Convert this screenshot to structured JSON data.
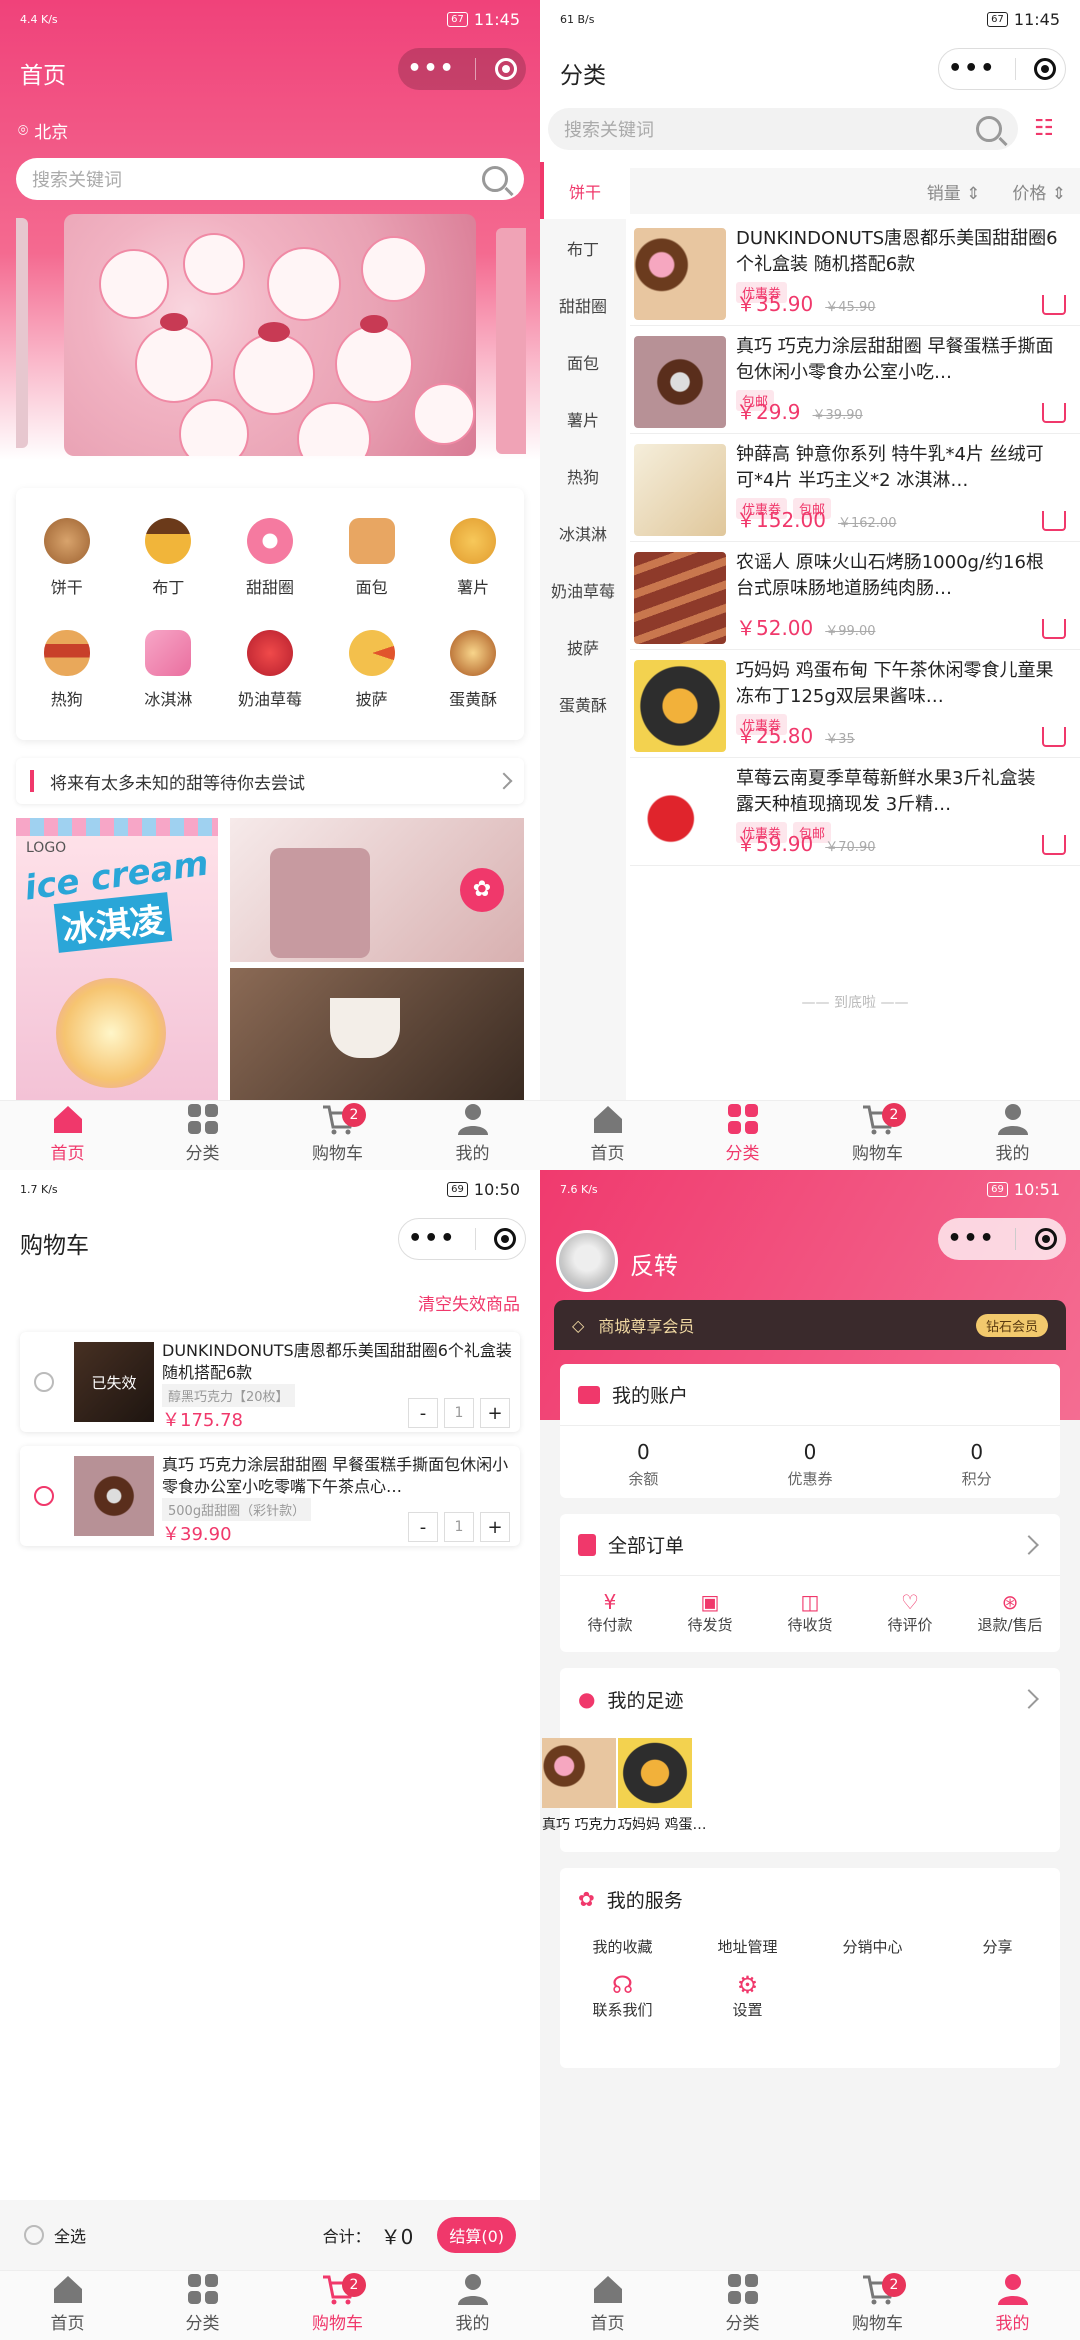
{
  "status": [
    {
      "speed": "4.4\nK/s",
      "battery": "67",
      "time": "11:45"
    },
    {
      "speed": "61\nB/s",
      "battery": "67",
      "time": "11:45"
    },
    {
      "speed": "1.7\nK/s",
      "battery": "69",
      "time": "10:50"
    },
    {
      "speed": "7.6\nK/s",
      "battery": "69",
      "time": "10:51"
    }
  ],
  "capsule": {
    "dots": "•••"
  },
  "tabbar": {
    "home": "首页",
    "category": "分类",
    "cart": "购物车",
    "mine": "我的",
    "cart_badge": "2"
  },
  "home": {
    "title": "首页",
    "location": "北京",
    "search_placeholder": "搜索关键词",
    "categories": [
      "饼干",
      "布丁",
      "甜甜圈",
      "面包",
      "薯片",
      "热狗",
      "冰淇淋",
      "奶油草莓",
      "披萨",
      "蛋黄酥"
    ],
    "notice": "将来有太多未知的甜等待你去尝试",
    "banner_ice": "ice cream",
    "banner_ice_cn": "冰淇凌",
    "banner_logo": "LOGO"
  },
  "category": {
    "title": "分类",
    "search_placeholder": "搜索关键词",
    "nav": [
      "饼干",
      "布丁",
      "甜甜圈",
      "面包",
      "薯片",
      "热狗",
      "冰淇淋",
      "奶油草莓",
      "披萨",
      "蛋黄酥"
    ],
    "sort_sales": "销量",
    "sort_price": "价格",
    "products": [
      {
        "title": "DUNKINDONUTS唐恩都乐美国甜甜圈6个礼盒装 随机搭配6款",
        "tags": [
          "优惠券"
        ],
        "price": "￥35.90",
        "old": "￥45.90"
      },
      {
        "title": "真巧 巧克力涂层甜甜圈 早餐蛋糕手撕面包休闲小零食办公室小吃…",
        "tags": [
          "包邮"
        ],
        "price": "￥29.9",
        "old": "￥39.90"
      },
      {
        "title": "钟薛高 钟意你系列 特牛乳*4片 丝绒可可*4片 半巧主义*2 冰淇淋…",
        "tags": [
          "优惠券",
          "包邮"
        ],
        "price": "￥152.00",
        "old": "￥162.00"
      },
      {
        "title": "农谣人 原味火山石烤肠1000g/约16根台式原味肠地道肠纯肉肠…",
        "tags": [],
        "price": "￥52.00",
        "old": "￥99.00"
      },
      {
        "title": "巧妈妈 鸡蛋布甸 下午茶休闲零食儿童果冻布丁125g双层果酱味…",
        "tags": [
          "优惠券"
        ],
        "price": "￥25.80",
        "old": "￥35"
      },
      {
        "title": "草莓云南夏季草莓新鲜水果3斤礼盒装 露天种植现摘现发 3斤精…",
        "tags": [
          "优惠券",
          "包邮"
        ],
        "price": "￥59.90",
        "old": "￥70.90"
      }
    ],
    "bottom": "—— 到底啦 ——"
  },
  "cart": {
    "title": "购物车",
    "clear": "清空失效商品",
    "items": [
      {
        "title": "DUNKINDONUTS唐恩都乐美国甜甜圈6个礼盒装 随机搭配6款",
        "spec": "醇黑巧克力【20枚】",
        "price": "￥175.78",
        "qty": "1",
        "invalid": "已失效"
      },
      {
        "title": "真巧 巧克力涂层甜甜圈 早餐蛋糕手撕面包休闲小零食办公室小吃零嘴下午茶点心…",
        "spec": "500g甜甜圈（彩针款）",
        "price": "￥39.90",
        "qty": "1"
      }
    ],
    "select_all": "全选",
    "total_label": "合计：",
    "total": "￥0",
    "checkout": "结算(0)"
  },
  "mine": {
    "username": "反转",
    "member": "商城尊享会员",
    "level": "钻石会员",
    "account": "我的账户",
    "stats": [
      {
        "v": "0",
        "l": "余额"
      },
      {
        "v": "0",
        "l": "优惠券"
      },
      {
        "v": "0",
        "l": "积分"
      }
    ],
    "orders": "全部订单",
    "order_items": [
      "待付款",
      "待发货",
      "待收货",
      "待评价",
      "退款/售后"
    ],
    "footprint": "我的足迹",
    "footprint_items": [
      "真巧 巧克力…",
      "巧妈妈 鸡蛋…"
    ],
    "services": "我的服务",
    "service_items": [
      "我的收藏",
      "地址管理",
      "分销中心",
      "分享",
      "联系我们",
      "设置"
    ]
  },
  "colors": {
    "accent": "#f0386b",
    "pink": "#f46a90"
  }
}
